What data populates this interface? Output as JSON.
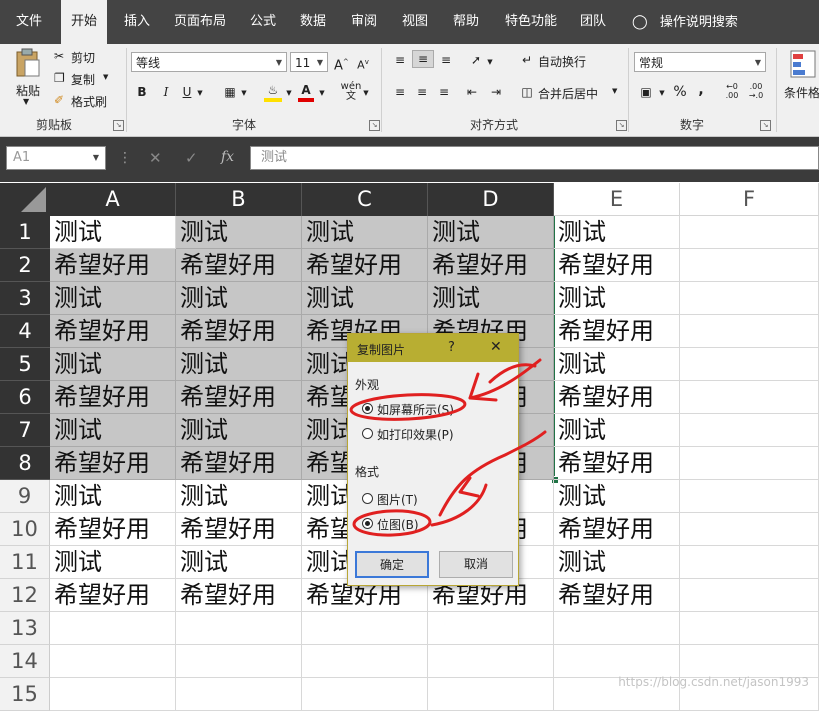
{
  "ribbon_tabs": [
    {
      "label": "文件"
    },
    {
      "label": "开始"
    },
    {
      "label": "插入"
    },
    {
      "label": "页面布局"
    },
    {
      "label": "公式"
    },
    {
      "label": "数据"
    },
    {
      "label": "审阅"
    },
    {
      "label": "视图"
    },
    {
      "label": "帮助"
    },
    {
      "label": "特色功能"
    },
    {
      "label": "团队"
    },
    {
      "label": "操作说明搜索"
    }
  ],
  "clipboard": {
    "paste": "粘贴",
    "cut": "剪切",
    "copy": "复制",
    "format_painter": "格式刷",
    "group": "剪贴板"
  },
  "font": {
    "name": "等线",
    "size": "11",
    "bold": "B",
    "italic": "I",
    "underline": "U",
    "grow": "A",
    "shrink": "A",
    "phonetic": "wén",
    "group": "字体"
  },
  "alignment": {
    "wrap": "自动换行",
    "merge": "合并后居中",
    "group": "对齐方式"
  },
  "number": {
    "format": "常规",
    "percent": "%",
    "comma": ",",
    "inc": ".00",
    "dec": ".0",
    "group": "数字"
  },
  "styles": {
    "conditional": "条件格"
  },
  "formula_bar": {
    "name_box": "A1",
    "fx": "fx",
    "content": "测试"
  },
  "columns": [
    "A",
    "B",
    "C",
    "D",
    "E",
    "F"
  ],
  "rows": [
    {
      "num": "1",
      "cells": [
        "测试",
        "测试",
        "测试",
        "测试",
        "测试",
        ""
      ]
    },
    {
      "num": "2",
      "cells": [
        "希望好用",
        "希望好用",
        "希望好用",
        "希望好用",
        "希望好用",
        ""
      ]
    },
    {
      "num": "3",
      "cells": [
        "测试",
        "测试",
        "测试",
        "测试",
        "测试",
        ""
      ]
    },
    {
      "num": "4",
      "cells": [
        "希望好用",
        "希望好用",
        "希望好用",
        "希望好用",
        "希望好用",
        ""
      ]
    },
    {
      "num": "5",
      "cells": [
        "测试",
        "测试",
        "测试",
        "测试",
        "测试",
        ""
      ]
    },
    {
      "num": "6",
      "cells": [
        "希望好用",
        "希望好用",
        "希望好用",
        "希望好用",
        "希望好用",
        ""
      ]
    },
    {
      "num": "7",
      "cells": [
        "测试",
        "测试",
        "测试",
        "测试",
        "测试",
        ""
      ]
    },
    {
      "num": "8",
      "cells": [
        "希望好用",
        "希望好用",
        "希望好用",
        "希望好用",
        "希望好用",
        ""
      ]
    },
    {
      "num": "9",
      "cells": [
        "测试",
        "测试",
        "测试",
        "测试",
        "测试",
        ""
      ]
    },
    {
      "num": "10",
      "cells": [
        "希望好用",
        "希望好用",
        "希望好用",
        "希望好用",
        "希望好用",
        ""
      ]
    },
    {
      "num": "11",
      "cells": [
        "测试",
        "测试",
        "测试",
        "测试",
        "测试",
        ""
      ]
    },
    {
      "num": "12",
      "cells": [
        "希望好用",
        "希望好用",
        "希望好用",
        "希望好用",
        "希望好用",
        ""
      ]
    },
    {
      "num": "13",
      "cells": [
        "",
        "",
        "",
        "",
        "",
        ""
      ]
    },
    {
      "num": "14",
      "cells": [
        "",
        "",
        "",
        "",
        "",
        ""
      ]
    },
    {
      "num": "15",
      "cells": [
        "",
        "",
        "",
        "",
        "",
        ""
      ]
    }
  ],
  "dialog": {
    "title": "复制图片",
    "help": "?",
    "close": "✕",
    "appearance_label": "外观",
    "as_shown_on_screen": "如屏幕所示(S)",
    "as_shown_when_printed": "如打印效果(P)",
    "format_label": "格式",
    "picture": "图片(T)",
    "bitmap": "位图(B)",
    "ok": "确定",
    "cancel": "取消",
    "selected_appearance": "as_shown_on_screen",
    "selected_format": "bitmap"
  },
  "watermark": "https://blog.csdn.net/jason1993",
  "colors": {
    "ribbon_dark": "#444444",
    "selection_gray": "#c6c6c6",
    "selection_border": "#217346",
    "dialog_title": "#b8ae32",
    "annotation_red": "#e02020"
  }
}
